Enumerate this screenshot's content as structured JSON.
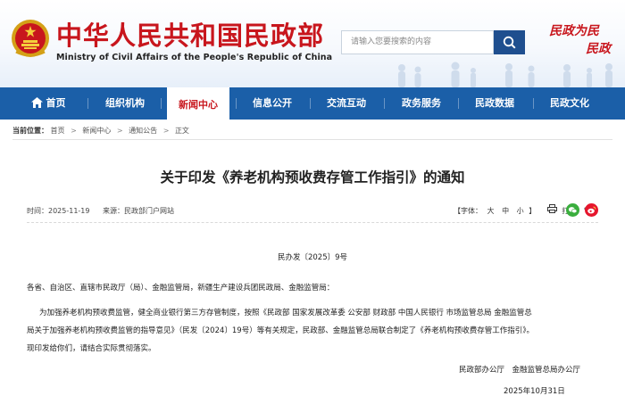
{
  "header": {
    "site_title": "中华人民共和国民政部",
    "site_subtitle": "Ministry of Civil Affairs of the People's Republic of China",
    "search_placeholder": "请输入您要搜索的内容",
    "calligraphy_line1": "民政为民",
    "calligraphy_line2": "民政",
    "brand_red": "#c8161d",
    "nav_blue": "#1b5fa8",
    "search_button_color": "#1f4f8f"
  },
  "nav": {
    "items": [
      {
        "label": "首页",
        "icon": "home-icon"
      },
      {
        "label": "组织机构"
      },
      {
        "label": "新闻中心",
        "active": true
      },
      {
        "label": "信息公开"
      },
      {
        "label": "交流互动"
      },
      {
        "label": "政务服务"
      },
      {
        "label": "民政数据"
      },
      {
        "label": "民政文化"
      }
    ]
  },
  "breadcrumb": {
    "prefix": "当前位置：",
    "items": [
      "首页",
      "新闻中心",
      "通知公告",
      "正文"
    ]
  },
  "article": {
    "title": "关于印发《养老机构预收费存管工作指引》的通知",
    "time_label": "时间：2025-11-19",
    "source_label": "来源：民政部门户网站",
    "font_label": "【字体：",
    "font_sizes": [
      "大",
      "中",
      "小"
    ],
    "font_close": "】",
    "print_label": "打印",
    "doc_number": "民办发〔2025〕9号",
    "addressee": "各省、自治区、直辖市民政厅（局）、金融监管局，新疆生产建设兵团民政局、金融监管局：",
    "body_lines": [
      "为加强养老机构预收费监管，健全商业银行第三方存管制度，按照《民政部 国家发展改革委 公安部 财政部 中国人民银行 市场监管总局 金融监管总",
      "局关于加强养老机构预收费监管的指导意见》（民发〔2024〕19号）等有关规定，民政部、金融监管总局联合制定了《养老机构预收费存管工作指引》。",
      "现印发给你们，请结合实际贯彻落实。"
    ],
    "signatories": "民政部办公厅　金融监管总局办公厅",
    "date": "2025年10月31日"
  },
  "icons": {
    "wechat_color": "#3aae3d",
    "weibo_color": "#e6162d"
  }
}
